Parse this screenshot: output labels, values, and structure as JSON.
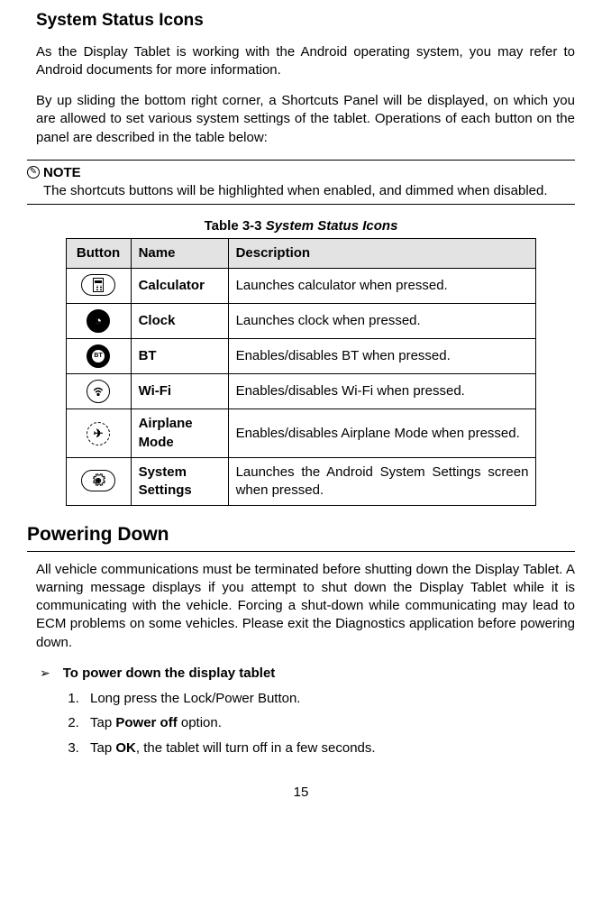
{
  "section1": {
    "heading": "System Status Icons",
    "p1": "As the Display Tablet is working with the Android operating system, you may refer to Android documents for more information.",
    "p2": "By up sliding the bottom right corner, a Shortcuts Panel will be displayed, on which you are allowed to set various system settings of the tablet. Operations of each button on the panel are described in the table below:"
  },
  "note": {
    "label": "NOTE",
    "body": "The shortcuts buttons will be highlighted when enabled, and dimmed when disabled."
  },
  "table": {
    "caption_a": "Table 3-3 ",
    "caption_b": "System Status Icons",
    "headers": {
      "button": "Button",
      "name": "Name",
      "desc": "Description"
    },
    "rows": [
      {
        "name": "Calculator",
        "desc": "Launches calculator when pressed."
      },
      {
        "name": "Clock",
        "desc": "Launches clock when pressed."
      },
      {
        "name": "BT",
        "desc": "Enables/disables BT when pressed."
      },
      {
        "name": "Wi-Fi",
        "desc": "Enables/disables Wi-Fi when pressed."
      },
      {
        "name": "Airplane Mode",
        "desc": "Enables/disables Airplane Mode when pressed."
      },
      {
        "name": "System Settings",
        "desc": "Launches the Android System Settings screen when pressed."
      }
    ]
  },
  "section2": {
    "heading": "Powering Down",
    "p1": "All vehicle communications must be terminated before shutting down the Display Tablet. A warning message displays if you attempt to shut down the Display Tablet while it is communicating with the vehicle. Forcing a shut-down while communicating may lead to ECM problems on some vehicles. Please exit the Diagnostics application before powering down.",
    "arrow_text": "To power down the display tablet",
    "steps": {
      "s1": "Long press the Lock/Power Button.",
      "s2_a": "Tap ",
      "s2_b": "Power off",
      "s2_c": " option.",
      "s3_a": "Tap ",
      "s3_b": "OK",
      "s3_c": ", the tablet will turn off in a few seconds."
    }
  },
  "page_number": "15"
}
